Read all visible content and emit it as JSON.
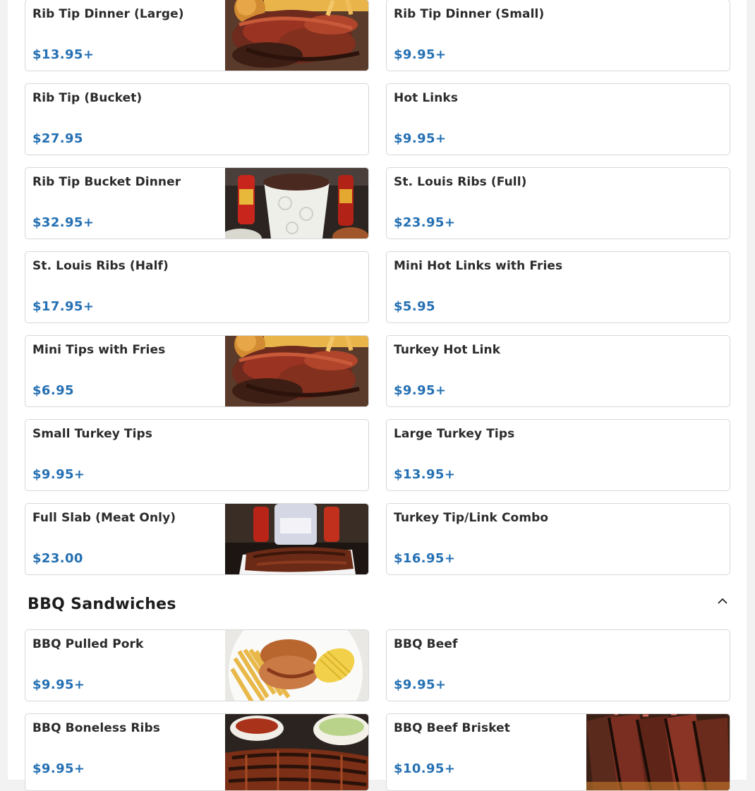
{
  "ribs_section": {
    "items": [
      {
        "name": "Rib Tip Dinner (Large)",
        "price": "$13.95+",
        "photo": "ribs-platter"
      },
      {
        "name": "Rib Tip Dinner (Small)",
        "price": "$9.95+",
        "photo": ""
      },
      {
        "name": "Rib Tip (Bucket)",
        "price": "$27.95",
        "photo": ""
      },
      {
        "name": "Hot Links",
        "price": "$9.95+",
        "photo": ""
      },
      {
        "name": "Rib Tip Bucket Dinner",
        "price": "$32.95+",
        "photo": "bucket-dinner"
      },
      {
        "name": "St. Louis Ribs (Full)",
        "price": "$23.95+",
        "photo": ""
      },
      {
        "name": "St. Louis Ribs (Half)",
        "price": "$17.95+",
        "photo": ""
      },
      {
        "name": "Mini Hot Links with Fries",
        "price": "$5.95",
        "photo": ""
      },
      {
        "name": "Mini Tips with Fries",
        "price": "$6.95",
        "photo": "ribs-platter"
      },
      {
        "name": "Turkey Hot Link",
        "price": "$9.95+",
        "photo": ""
      },
      {
        "name": "Small Turkey Tips",
        "price": "$9.95+",
        "photo": ""
      },
      {
        "name": "Large Turkey Tips",
        "price": "$13.95+",
        "photo": ""
      },
      {
        "name": "Full Slab (Meat Only)",
        "price": "$23.00",
        "photo": "full-slab"
      },
      {
        "name": "Turkey Tip/Link Combo",
        "price": "$16.95+",
        "photo": ""
      }
    ]
  },
  "sandwiches_section": {
    "title": "BBQ Sandwiches",
    "toggle_icon": "chevron-up-icon",
    "items": [
      {
        "name": "BBQ Pulled Pork",
        "price": "$9.95+",
        "photo": "pulled-pork"
      },
      {
        "name": "BBQ Beef",
        "price": "$9.95+",
        "photo": ""
      },
      {
        "name": "BBQ Boneless Ribs",
        "price": "$9.95+",
        "photo": "boneless-ribs"
      },
      {
        "name": "BBQ Beef Brisket",
        "price": "$10.95+",
        "photo": "brisket"
      }
    ]
  },
  "colors": {
    "price": "#2470b3",
    "item_name": "#2b2b2b",
    "card_border": "#d8d8d8",
    "page_background": "#f2f2f2"
  }
}
